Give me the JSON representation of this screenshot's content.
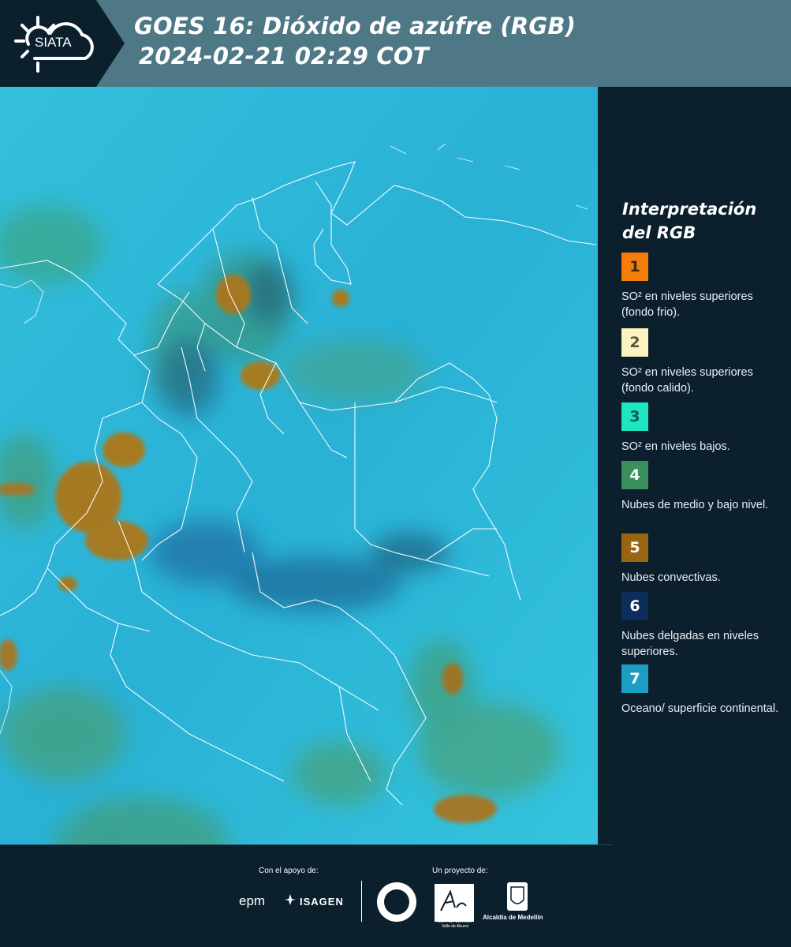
{
  "header": {
    "logo_text": "SIATA",
    "title_line1": "GOES 16: Dióxido de azúfre (RGB)",
    "title_line2": "2024-02-21 02:29 COT"
  },
  "legend": {
    "title": "Interpretación del RGB",
    "items": [
      {
        "number": "1",
        "text": "SO² en niveles superiores (fondo frio).",
        "color": "#f57e0b",
        "number_color": "#3a2a10"
      },
      {
        "number": "2",
        "text": "SO² en niveles superiores (fondo calido).",
        "color": "#fdf3c0",
        "number_color": "#5a5540"
      },
      {
        "number": "3",
        "text": "SO² en niveles bajos.",
        "color": "#1ee6c2",
        "number_color": "#0e5a4f"
      },
      {
        "number": "4",
        "text": "Nubes de medio y bajo nivel.",
        "color": "#3b8f5d",
        "number_color": "#ffffff"
      },
      {
        "number": "5",
        "text": "Nubes convectivas.",
        "color": "#9a6513",
        "number_color": "#ffffff"
      },
      {
        "number": "6",
        "text": "Nubes delgadas en niveles superiores.",
        "color": "#0c2e5c",
        "number_color": "#ffffff"
      },
      {
        "number": "7",
        "text": "Oceano/ superficie continental.",
        "color": "#1c9ec4",
        "number_color": "#ffffff"
      }
    ]
  },
  "footer": {
    "support_label": "Con el apoyo de:",
    "project_label": "Un proyecto de:",
    "sponsor1": "epm",
    "sponsor2": "ISAGEN",
    "area_text": "METROPOLITANA Valle de Aburrá",
    "alcaldia": "Alcaldía de Medellín"
  }
}
